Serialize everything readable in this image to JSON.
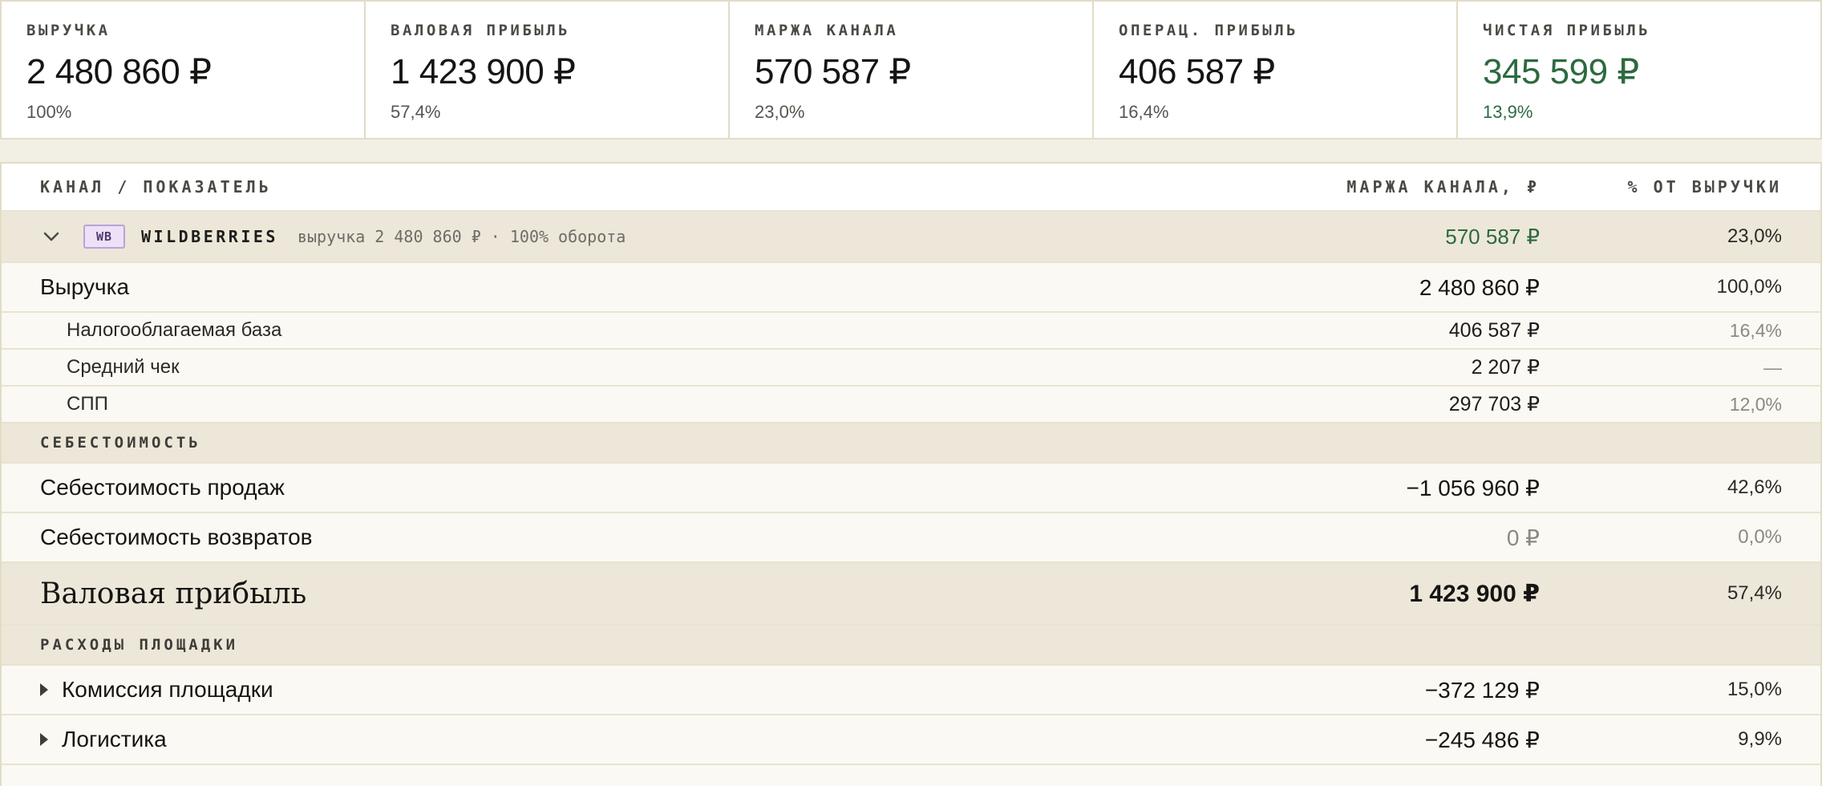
{
  "kpis": [
    {
      "label": "ВЫРУЧКА",
      "value": "2 480 860 ₽",
      "pct": "100%"
    },
    {
      "label": "ВАЛОВАЯ ПРИБЫЛЬ",
      "value": "1 423 900 ₽",
      "pct": "57,4%"
    },
    {
      "label": "МАРЖА КАНАЛА",
      "value": "570 587 ₽",
      "pct": "23,0%"
    },
    {
      "label": "ОПЕРАЦ. ПРИБЫЛЬ",
      "value": "406 587 ₽",
      "pct": "16,4%"
    },
    {
      "label": "ЧИСТАЯ ПРИБЫЛЬ",
      "value": "345 599 ₽",
      "pct": "13,9%"
    }
  ],
  "colors": {
    "accent_green": "#2c6a3f",
    "badge_purple": "#ece1f7"
  },
  "table": {
    "headers": {
      "name": "КАНАЛ / ПОКАЗАТЕЛЬ",
      "value": "МАРЖА КАНАЛА, ₽",
      "pct": "% ОТ ВЫРУЧКИ"
    },
    "channel": {
      "badge": "WB",
      "name": "WILDBERRIES",
      "subtitle": "выручка 2 480 860 ₽ · 100% оборота",
      "value": "570 587 ₽",
      "pct": "23,0%",
      "icon": "chevron-down-icon"
    },
    "revenue": {
      "label": "Выручка",
      "value": "2 480 860 ₽",
      "pct": "100,0%"
    },
    "revenue_sub": [
      {
        "label": "Налогооблагаемая база",
        "value": "406 587 ₽",
        "pct": "16,4%"
      },
      {
        "label": "Средний чек",
        "value": "2 207 ₽",
        "pct": "—"
      },
      {
        "label": "СПП",
        "value": "297 703 ₽",
        "pct": "12,0%"
      }
    ],
    "section_cost": "СЕБЕСТОИМОСТЬ",
    "cost_rows": [
      {
        "label": "Себестоимость продаж",
        "value": "−1 056 960 ₽",
        "pct": "42,6%"
      },
      {
        "label": "Себестоимость возвратов",
        "value": "0 ₽",
        "pct": "0,0%"
      }
    ],
    "gross": {
      "label": "Валовая прибыль",
      "value": "1 423 900 ₽",
      "pct": "57,4%"
    },
    "section_platform": "РАСХОДЫ ПЛОЩАДКИ",
    "platform_rows": [
      {
        "label": "Комиссия площадки",
        "value": "−372 129 ₽",
        "pct": "15,0%"
      },
      {
        "label": "Логистика",
        "value": "−245 486 ₽",
        "pct": "9,9%"
      }
    ]
  }
}
